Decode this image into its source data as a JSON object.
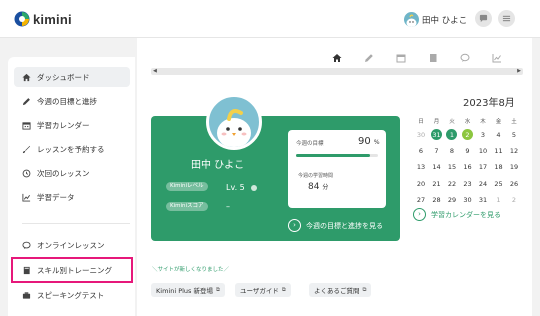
{
  "header": {
    "logo_text": "kimini",
    "user_name": "田中 ひよこ",
    "icons": [
      "chat-icon",
      "menu-icon"
    ]
  },
  "sidebar": {
    "items": [
      {
        "label": "ダッシュボード",
        "icon": "home-icon",
        "active": true
      },
      {
        "label": "今週の目標と進捗",
        "icon": "pencil-icon"
      },
      {
        "label": "学習カレンダー",
        "icon": "calendar-icon"
      },
      {
        "label": "レッスンを予約する",
        "icon": "brush-icon"
      },
      {
        "label": "次回のレッスン",
        "icon": "clock-icon"
      },
      {
        "label": "学習データ",
        "icon": "chart-icon"
      }
    ],
    "items2": [
      {
        "label": "オンラインレッスン",
        "icon": "chat-icon"
      },
      {
        "label": "スキル別トレーニング",
        "icon": "book-icon",
        "highlighted": true
      },
      {
        "label": "スピーキングテスト",
        "icon": "mic-icon"
      }
    ]
  },
  "tabs": [
    "home-icon",
    "pencil-icon",
    "calendar-icon",
    "book-icon",
    "chat-icon",
    "chart-icon"
  ],
  "profile": {
    "name": "田中 ひよこ",
    "level_pill": "Kiminiレベル",
    "level_value": "Lv. 5",
    "score_pill": "Kiminiスコア",
    "score_value": "–"
  },
  "goal": {
    "label": "今週の目標",
    "value": "90",
    "unit": "%",
    "progress": 0.9,
    "time_label": "今週の学習時間",
    "time_value": "84",
    "time_unit": "分",
    "link": "今週の目標と進捗を見る"
  },
  "calendar": {
    "title": "2023年8月",
    "weekdays": [
      "日",
      "月",
      "火",
      "水",
      "木",
      "金",
      "土"
    ],
    "weeks": [
      [
        "30",
        "31",
        "1",
        "2",
        "3",
        "4",
        "5"
      ],
      [
        "6",
        "7",
        "8",
        "9",
        "10",
        "11",
        "12"
      ],
      [
        "13",
        "14",
        "15",
        "16",
        "17",
        "18",
        "19"
      ],
      [
        "20",
        "21",
        "22",
        "23",
        "24",
        "25",
        "26"
      ],
      [
        "27",
        "28",
        "29",
        "30",
        "31",
        "1",
        "2"
      ]
    ],
    "link": "学習カレンダーを見る",
    "colors": {
      "studied": "#2e9b6a",
      "today": "#8cc63f"
    }
  },
  "bottom": {
    "note": "＼サイトが新しくなりました／",
    "chips": [
      "Kimini Plus 新登場",
      "ユーザガイド",
      "よくあるご質問"
    ]
  },
  "colors": {
    "accent": "#2e9b6a",
    "highlight": "#e6187a"
  }
}
